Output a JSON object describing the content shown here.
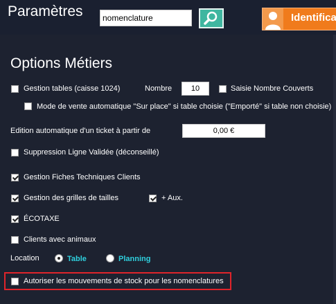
{
  "header": {
    "title": "Paramètres",
    "search_value": "nomenclature",
    "ident_label": "Identifica"
  },
  "section": {
    "title": "Options Métiers"
  },
  "options": {
    "gestion_tables": {
      "label": "Gestion tables (caisse 1024)",
      "checked": false
    },
    "nombre": {
      "label": "Nombre",
      "value": "10"
    },
    "saisie_couverts": {
      "label": "Saisie Nombre Couverts",
      "checked": false
    },
    "mode_vente": {
      "label": "Mode de vente automatique \"Sur place\" si table choisie (\"Emporté\" si table non choisie)",
      "checked": false
    },
    "edition_ticket": {
      "label": "Edition automatique d'un ticket à partir de",
      "value": "0,00 €"
    },
    "suppression": {
      "label": "Suppression Ligne Validée (déconseillé)",
      "checked": false
    },
    "fiches_techniques": {
      "label": "Gestion Fiches Techniques Clients",
      "checked": true
    },
    "grilles_tailles": {
      "label": "Gestion des grilles de tailles",
      "checked": true
    },
    "aux": {
      "label": "+ Aux.",
      "checked": true
    },
    "ecotaxe": {
      "label": "ÉCOTAXE",
      "checked": true
    },
    "animaux": {
      "label": "Clients avec animaux",
      "checked": false
    },
    "location": {
      "label": "Location",
      "options": [
        "Table",
        "Planning"
      ],
      "selected": "Table"
    },
    "mouvements_stock": {
      "label": "Autoriser les mouvements de stock pour les nomenclatures",
      "checked": false
    }
  },
  "colors": {
    "background": "#1d2230",
    "accent_teal": "#3fb6a0",
    "accent_orange": "#f07b1c",
    "radio_label": "#2fd0de",
    "highlight": "#e0242a"
  },
  "icons": {
    "search": "magnifier-icon",
    "user": "user-silhouette-icon"
  }
}
